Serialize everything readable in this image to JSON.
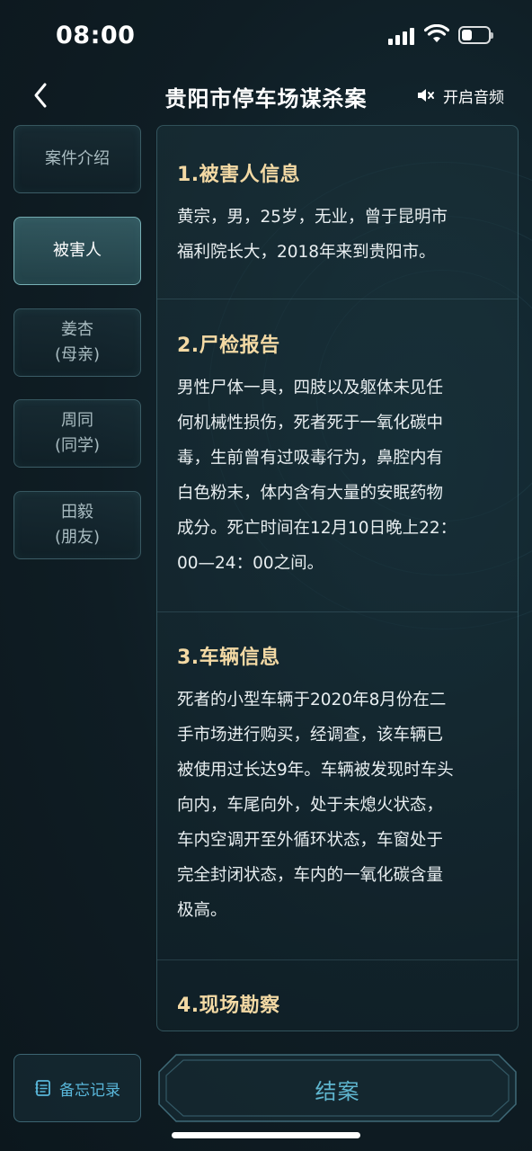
{
  "status_bar": {
    "time": "08:00",
    "battery_level": 0.4
  },
  "header": {
    "title": "贵阳市停车场谋杀案",
    "audio_label": "开启音频"
  },
  "sidebar": {
    "items": [
      {
        "label": "案件介绍",
        "sub": "",
        "active": false
      },
      {
        "label": "被害人",
        "sub": "",
        "active": true
      },
      {
        "label": "姜杏",
        "sub": "(母亲)",
        "active": false
      },
      {
        "label": "周同",
        "sub": "(同学)",
        "active": false
      },
      {
        "label": "田毅",
        "sub": "(朋友)",
        "active": false
      }
    ]
  },
  "sections": [
    {
      "title": "1.被害人信息",
      "lines": [
        "黄宗，男，25岁，无业，曾于昆明市",
        "福利院长大，2018年来到贵阳市。"
      ]
    },
    {
      "title": "2.尸检报告",
      "lines": [
        "男性尸体一具，四肢以及躯体未见任",
        "何机械性损伤，死者死于一氧化碳中",
        "毒，生前曾有过吸毒行为，鼻腔内有",
        "白色粉末，体内含有大量的安眠药物",
        "成分。死亡时间在12月10日晚上22：",
        "00—24：00之间。"
      ]
    },
    {
      "title": "3.车辆信息",
      "lines": [
        "死者的小型车辆于2020年8月份在二",
        "手市场进行购买，经调查，该车辆已",
        "被使用过长达9年。车辆被发现时车头",
        "向内，车尾向外，处于未熄火状态，",
        "车内空调开至外循环状态，车窗处于",
        "完全封闭状态，车内的一氧化碳含量",
        "极高。"
      ]
    },
    {
      "title": "4.现场勘察",
      "lines": []
    }
  ],
  "footer": {
    "memo_label": "备忘记录",
    "close_case_label": "结案"
  },
  "colors": {
    "section_title": "#f3d9a4",
    "accent": "#5fb6cf",
    "memo": "#59b7da"
  }
}
